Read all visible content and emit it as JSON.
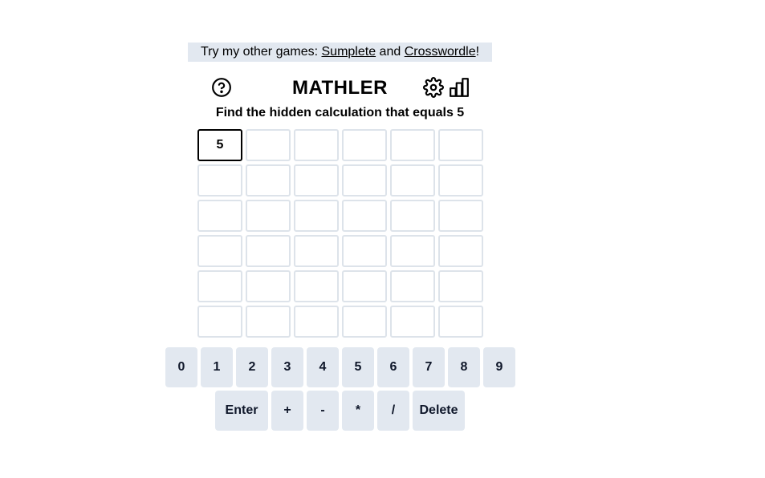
{
  "promo": {
    "prefix": "Try my other games: ",
    "link1": "Sumplete",
    "middle": " and ",
    "link2": "Crosswordle",
    "suffix": "!"
  },
  "header": {
    "title": "MATHLER",
    "help_icon": "help-circle-icon",
    "settings_icon": "gear-icon",
    "stats_icon": "bar-chart-icon"
  },
  "subtitle": "Find the hidden calculation that equals 5",
  "grid": {
    "rows": [
      [
        "5",
        "",
        "",
        "",
        "",
        ""
      ],
      [
        "",
        "",
        "",
        "",
        "",
        ""
      ],
      [
        "",
        "",
        "",
        "",
        "",
        ""
      ],
      [
        "",
        "",
        "",
        "",
        "",
        ""
      ],
      [
        "",
        "",
        "",
        "",
        "",
        ""
      ],
      [
        "",
        "",
        "",
        "",
        "",
        ""
      ]
    ]
  },
  "keyboard": {
    "row1": [
      "0",
      "1",
      "2",
      "3",
      "4",
      "5",
      "6",
      "7",
      "8",
      "9"
    ],
    "row2": [
      "Enter",
      "+",
      "-",
      "*",
      "/",
      "Delete"
    ]
  }
}
